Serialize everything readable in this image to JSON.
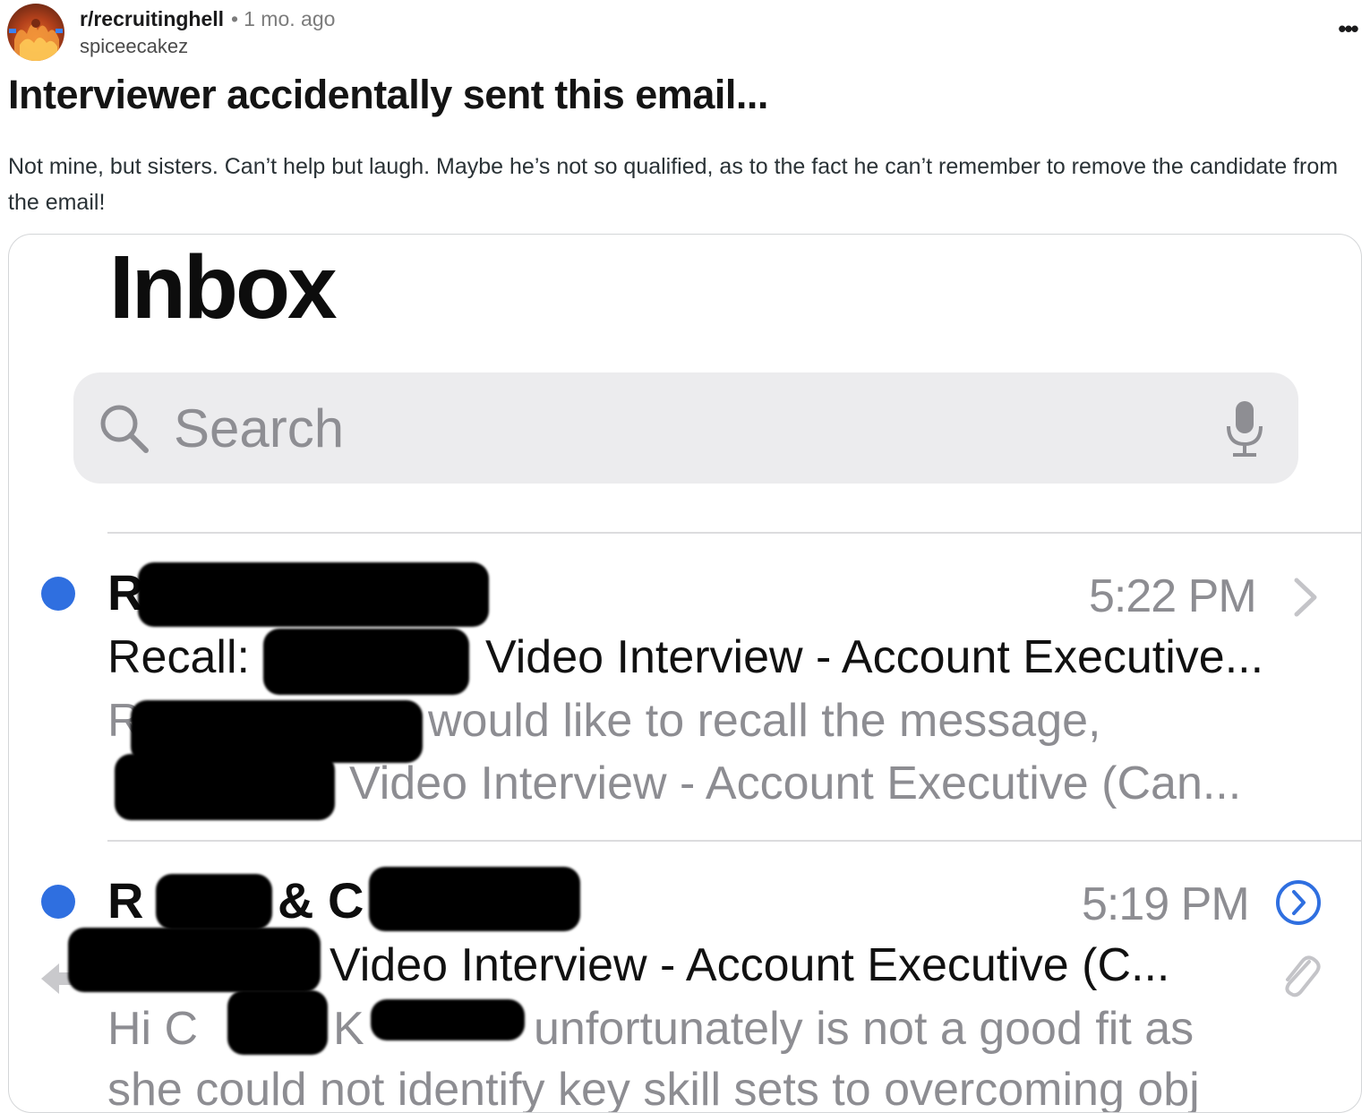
{
  "post": {
    "subreddit": "r/recruitinghell",
    "separator": "•",
    "age": "1 mo. ago",
    "author": "spiceecakez",
    "more_label": "•••",
    "title": "Interviewer accidentally sent this email...",
    "body": "Not mine, but sisters. Can’t help but laugh. Maybe he’s not so qualified, as to the fact he can’t remember to remove the candidate from the email!"
  },
  "screenshot": {
    "inbox_title": "Inbox",
    "search": {
      "placeholder": "Search",
      "icon": "search-icon",
      "mic_icon": "microphone-icon"
    },
    "emails": [
      {
        "unread": true,
        "sender_visible": "R",
        "time": "5:22 PM",
        "subject_prefix": "Recall:",
        "subject_rest": "Video Interview - Account Executive...",
        "preview_line1_prefix": "R",
        "preview_line1_rest": "would like to recall the message,",
        "preview_line2": "Video Interview - Account Executive (Can...",
        "trailing_icon": "chevron-right-icon"
      },
      {
        "unread": true,
        "sender_visible_a": "R",
        "sender_visible_b": "& C",
        "time": "5:19 PM",
        "subject_rest": "Video Interview - Account Executive (C...",
        "preview_line1_a": "Hi C",
        "preview_line1_b": "K",
        "preview_line1_c": "unfortunately is not a good fit as",
        "preview_line2": "she could not identify key skill sets to overcoming obj",
        "trailing_icon": "circle-chevron-icon",
        "attachment_icon": "paperclip-icon",
        "reply_icon": "reply-arrow-icon"
      }
    ],
    "colors": {
      "unread_dot": "#2f6fe0",
      "search_bg": "#ececee",
      "secondary_text": "#8d8d92",
      "redaction": "#000000"
    }
  }
}
